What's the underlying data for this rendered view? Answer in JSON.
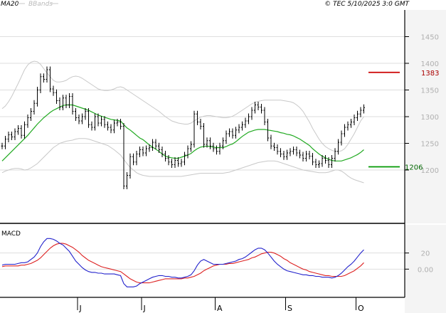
{
  "legend": {
    "ma": "MA20",
    "bbands": "BBands"
  },
  "copyright": "© TEC 5/10/2025 3:0 GMT",
  "colors": {
    "price": "#000000",
    "ma20": "#22aa22",
    "bbands": "#c8c8c8",
    "macd": "#2222cc",
    "signal": "#dd2222",
    "level_red": "#cc0000",
    "level_green": "#009900",
    "frame": "#000000",
    "shade": "#f4f4f4",
    "tick": "#b0b0b0"
  },
  "chart_data": [
    {
      "type": "candlestick",
      "title": "",
      "y_ticks": [
        1200,
        1250,
        1300,
        1350,
        1400,
        1450
      ],
      "ylim": [
        1100,
        1500
      ],
      "month_labels": [
        {
          "label": "J",
          "index": 24
        },
        {
          "label": "J",
          "index": 44
        },
        {
          "label": "A",
          "index": 67
        },
        {
          "label": "S",
          "index": 89
        },
        {
          "label": "O",
          "index": 111
        }
      ],
      "levels": [
        {
          "name": "resistance",
          "value": 1383,
          "label": "1383",
          "color": "#cc0000"
        },
        {
          "name": "support",
          "value": 1206,
          "label": "1206",
          "color": "#009900"
        }
      ],
      "closes": [
        1245,
        1258,
        1266,
        1262,
        1272,
        1278,
        1265,
        1285,
        1298,
        1310,
        1325,
        1350,
        1375,
        1370,
        1388,
        1352,
        1345,
        1330,
        1318,
        1335,
        1322,
        1338,
        1310,
        1298,
        1292,
        1300,
        1310,
        1285,
        1280,
        1300,
        1288,
        1295,
        1285,
        1280,
        1275,
        1288,
        1290,
        1282,
        1170,
        1190,
        1225,
        1215,
        1230,
        1238,
        1232,
        1240,
        1242,
        1252,
        1245,
        1238,
        1230,
        1222,
        1215,
        1210,
        1218,
        1212,
        1215,
        1228,
        1240,
        1248,
        1305,
        1290,
        1282,
        1248,
        1255,
        1245,
        1240,
        1235,
        1245,
        1255,
        1268,
        1272,
        1265,
        1275,
        1280,
        1285,
        1292,
        1300,
        1312,
        1322,
        1318,
        1312,
        1290,
        1260,
        1245,
        1242,
        1235,
        1230,
        1225,
        1232,
        1235,
        1238,
        1232,
        1228,
        1222,
        1230,
        1226,
        1215,
        1210,
        1212,
        1222,
        1218,
        1210,
        1222,
        1235,
        1252,
        1268,
        1280,
        1285,
        1290,
        1298,
        1305,
        1312,
        1317
      ],
      "ma20": [
        1217,
        1223,
        1229,
        1235,
        1241,
        1247,
        1253,
        1259,
        1265,
        1272,
        1279,
        1286,
        1292,
        1298,
        1303,
        1308,
        1312,
        1315,
        1318,
        1321,
        1322,
        1322,
        1322,
        1320,
        1318,
        1316,
        1314,
        1312,
        1309,
        1306,
        1303,
        1301,
        1299,
        1297,
        1295,
        1294,
        1293,
        1292,
        1285,
        1279,
        1275,
        1270,
        1265,
        1260,
        1257,
        1252,
        1247,
        1243,
        1239,
        1235,
        1230,
        1226,
        1224,
        1223,
        1222,
        1222,
        1224,
        1226,
        1228,
        1231,
        1236,
        1240,
        1243,
        1244,
        1245,
        1244,
        1243,
        1242,
        1242,
        1242,
        1244,
        1247,
        1249,
        1253,
        1258,
        1263,
        1267,
        1271,
        1273,
        1275,
        1276,
        1276,
        1276,
        1275,
        1274,
        1273,
        1272,
        1270,
        1269,
        1267,
        1266,
        1264,
        1261,
        1258,
        1254,
        1250,
        1246,
        1240,
        1235,
        1230,
        1226,
        1223,
        1220,
        1218,
        1217,
        1217,
        1217,
        1219,
        1221,
        1223,
        1226,
        1229,
        1233,
        1238
      ],
      "bb_upper": [
        1315,
        1320,
        1328,
        1338,
        1350,
        1362,
        1375,
        1388,
        1397,
        1402,
        1404,
        1403,
        1398,
        1390,
        1382,
        1375,
        1368,
        1365,
        1365,
        1366,
        1368,
        1372,
        1375,
        1376,
        1375,
        1372,
        1368,
        1364,
        1360,
        1356,
        1352,
        1350,
        1349,
        1349,
        1350,
        1352,
        1355,
        1356,
        1354,
        1350,
        1346,
        1342,
        1338,
        1334,
        1330,
        1326,
        1322,
        1318,
        1314,
        1310,
        1305,
        1300,
        1296,
        1292,
        1290,
        1288,
        1287,
        1286,
        1286,
        1288,
        1292,
        1296,
        1299,
        1301,
        1302,
        1302,
        1301,
        1300,
        1299,
        1298,
        1298,
        1299,
        1301,
        1304,
        1308,
        1312,
        1316,
        1320,
        1324,
        1327,
        1329,
        1330,
        1331,
        1331,
        1331,
        1331,
        1331,
        1331,
        1330,
        1329,
        1328,
        1326,
        1322,
        1317,
        1310,
        1300,
        1290,
        1278,
        1268,
        1258,
        1250,
        1244,
        1240,
        1237,
        1235,
        1235,
        1236,
        1240,
        1248,
        1258,
        1268,
        1280,
        1292,
        1300
      ],
      "bb_lower": [
        1195,
        1198,
        1200,
        1202,
        1203,
        1203,
        1202,
        1200,
        1201,
        1204,
        1208,
        1212,
        1218,
        1224,
        1230,
        1236,
        1242,
        1246,
        1250,
        1252,
        1254,
        1255,
        1256,
        1258,
        1259,
        1259,
        1259,
        1258,
        1256,
        1254,
        1252,
        1250,
        1248,
        1246,
        1242,
        1238,
        1233,
        1228,
        1220,
        1212,
        1205,
        1200,
        1195,
        1192,
        1190,
        1189,
        1188,
        1188,
        1188,
        1188,
        1188,
        1188,
        1188,
        1188,
        1188,
        1188,
        1188,
        1189,
        1190,
        1191,
        1192,
        1193,
        1194,
        1194,
        1194,
        1194,
        1194,
        1194,
        1194,
        1194,
        1195,
        1196,
        1198,
        1200,
        1202,
        1204,
        1206,
        1208,
        1210,
        1212,
        1214,
        1215,
        1216,
        1217,
        1217,
        1217,
        1216,
        1214,
        1212,
        1210,
        1208,
        1206,
        1204,
        1202,
        1200,
        1199,
        1198,
        1197,
        1196,
        1195,
        1195,
        1195,
        1196,
        1198,
        1200,
        1200,
        1198,
        1194,
        1189,
        1185,
        1182,
        1180,
        1178,
        1176
      ]
    },
    {
      "type": "line",
      "title": "MACD",
      "y_ticks": [
        0,
        20
      ],
      "ylim": [
        -35,
        55
      ],
      "macd": [
        5,
        6,
        6,
        6,
        6,
        7,
        8,
        8,
        9,
        12,
        15,
        20,
        28,
        34,
        38,
        38,
        37,
        35,
        32,
        30,
        26,
        22,
        16,
        10,
        6,
        2,
        -1,
        -3,
        -4,
        -4,
        -5,
        -5,
        -6,
        -6,
        -6,
        -6,
        -7,
        -8,
        -18,
        -22,
        -22,
        -22,
        -21,
        -18,
        -16,
        -14,
        -12,
        -10,
        -9,
        -8,
        -8,
        -9,
        -9,
        -10,
        -10,
        -11,
        -11,
        -10,
        -9,
        -7,
        -2,
        5,
        10,
        12,
        10,
        8,
        6,
        6,
        6,
        6,
        7,
        8,
        9,
        10,
        12,
        13,
        15,
        18,
        21,
        24,
        26,
        26,
        24,
        20,
        15,
        10,
        6,
        3,
        0,
        -2,
        -3,
        -4,
        -5,
        -6,
        -7,
        -7,
        -8,
        -8,
        -9,
        -9,
        -10,
        -10,
        -10,
        -11,
        -10,
        -8,
        -5,
        -1,
        3,
        6,
        10,
        15,
        20,
        24
      ],
      "signal": [
        3,
        4,
        4,
        4,
        4,
        4,
        5,
        5,
        6,
        7,
        9,
        11,
        14,
        18,
        22,
        26,
        29,
        31,
        32,
        32,
        31,
        29,
        27,
        24,
        21,
        17,
        14,
        11,
        9,
        7,
        5,
        3,
        2,
        1,
        0,
        -1,
        -2,
        -3,
        -6,
        -9,
        -12,
        -14,
        -16,
        -17,
        -17,
        -17,
        -17,
        -16,
        -15,
        -14,
        -13,
        -12,
        -12,
        -12,
        -12,
        -12,
        -12,
        -11,
        -11,
        -10,
        -9,
        -7,
        -5,
        -2,
        0,
        2,
        4,
        5,
        6,
        6,
        6,
        7,
        7,
        8,
        9,
        10,
        11,
        12,
        14,
        15,
        17,
        19,
        20,
        21,
        21,
        20,
        18,
        16,
        13,
        11,
        8,
        6,
        4,
        2,
        0,
        -1,
        -3,
        -4,
        -5,
        -6,
        -7,
        -8,
        -8,
        -9,
        -9,
        -9,
        -9,
        -8,
        -6,
        -4,
        -2,
        1,
        4,
        8
      ]
    }
  ]
}
